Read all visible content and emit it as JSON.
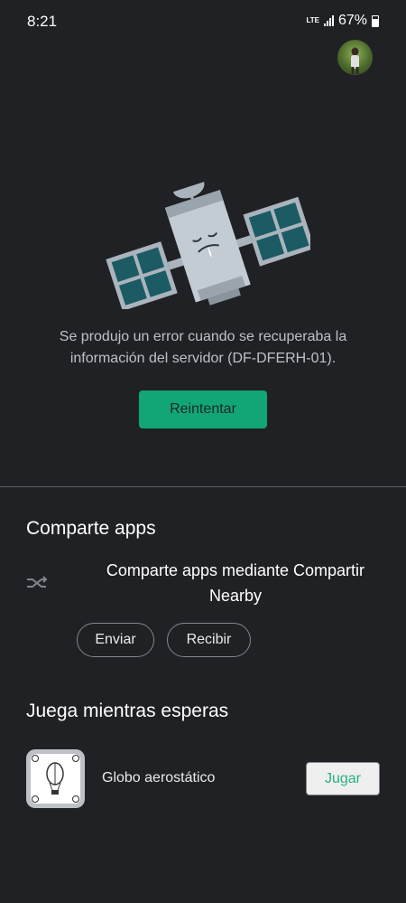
{
  "status_bar": {
    "time": "8:21",
    "network": "LTE",
    "battery": "67%"
  },
  "error": {
    "message_line1": "Se produjo un error cuando se recuperaba la",
    "message_line2": "información del servidor (DF-DFERH-01).",
    "retry_label": "Reintentar"
  },
  "share": {
    "title": "Comparte apps",
    "description_line1": "Comparte apps mediante Compartir",
    "description_line2": "Nearby",
    "send_label": "Enviar",
    "receive_label": "Recibir"
  },
  "games": {
    "title": "Juega mientras esperas",
    "items": [
      {
        "name": "Globo aerostático",
        "action_label": "Jugar"
      }
    ]
  },
  "colors": {
    "background": "#202124",
    "accent": "#12a577",
    "text_secondary": "#bdc1c6"
  }
}
